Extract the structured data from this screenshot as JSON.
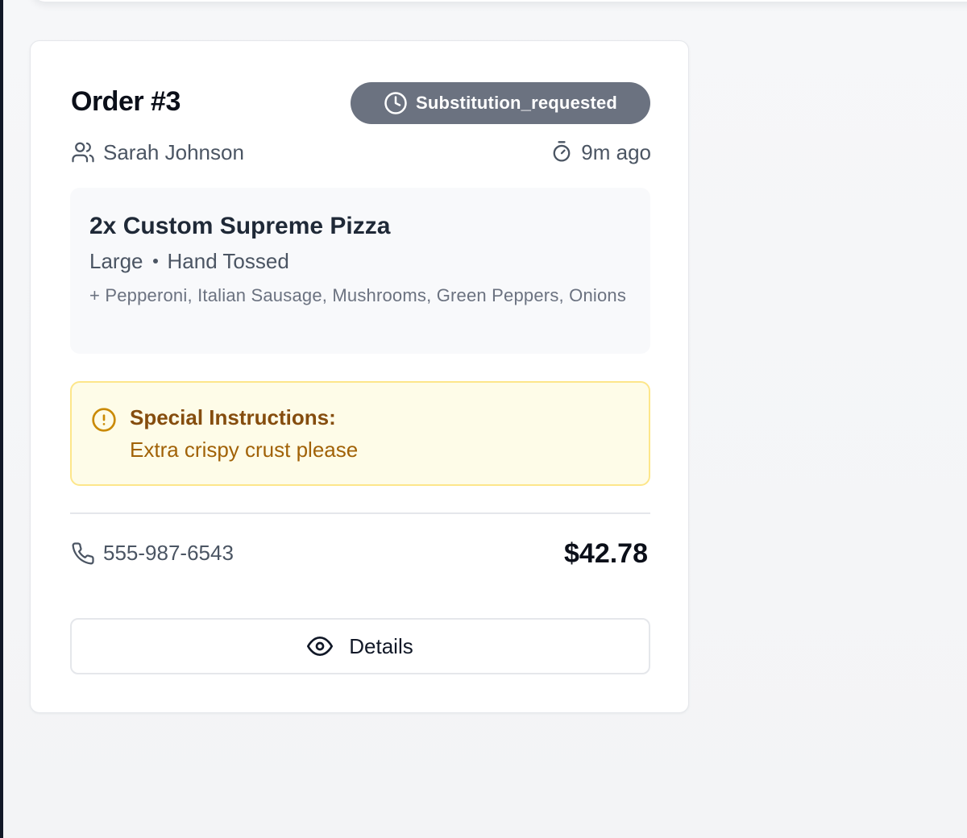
{
  "order": {
    "title": "Order #3",
    "status": "Substitution_requested",
    "customer_name": "Sarah Johnson",
    "time_ago": "9m ago"
  },
  "item": {
    "name": "2x Custom Supreme Pizza",
    "size": "Large",
    "crust": "Hand Tossed",
    "toppings": "+ Pepperoni, Italian Sausage, Mushrooms, Green Peppers, Onions"
  },
  "special_instructions": {
    "label": "Special Instructions:",
    "text": "Extra crispy crust please"
  },
  "contact": {
    "phone": "555-987-6543"
  },
  "total": "$42.78",
  "actions": {
    "details_label": "Details"
  },
  "icons": {
    "status": "clock-icon",
    "customer": "users-icon",
    "time": "timer-icon",
    "instructions": "alert-circle-icon",
    "phone": "phone-icon",
    "details": "eye-icon"
  },
  "colors": {
    "status_badge_bg": "#6b7280",
    "instructions_bg": "#fefce8",
    "instructions_border": "#fde68a",
    "instructions_title": "#854d0e",
    "instructions_text": "#a16207"
  }
}
